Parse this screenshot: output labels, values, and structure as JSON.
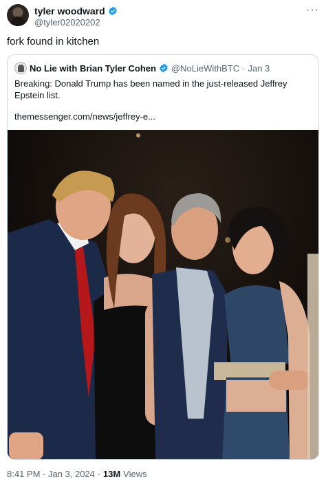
{
  "author": {
    "display_name": "tyler woodward",
    "handle": "@tyler02020202"
  },
  "tweet": {
    "text": "fork found in kitchen"
  },
  "more_icon": "more-options-icon",
  "quoted": {
    "display_name": "No Lie with Brian Tyler Cohen",
    "handle": "@NoLieWithBTC",
    "separator": "·",
    "date": "Jan 3",
    "text": "Breaking: Donald Trump has been named in the just-released Jeffrey Epstein list.",
    "link": "themessenger.com/news/jeffrey-e..."
  },
  "meta": {
    "timestamp": "8:41 PM · Jan 3, 2024 ·",
    "views_count": "13M",
    "views_label": "Views"
  },
  "colors": {
    "verified": "#1d9bf0",
    "secondary_text": "#536471",
    "border": "#cfd9de"
  }
}
